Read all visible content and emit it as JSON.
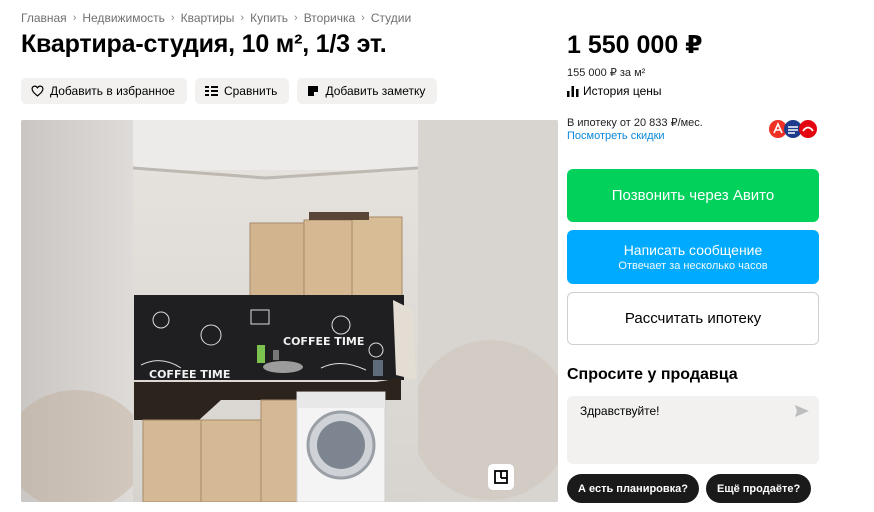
{
  "breadcrumbs": [
    "Главная",
    "Недвижимость",
    "Квартиры",
    "Купить",
    "Вторичка",
    "Студии"
  ],
  "title": "Квартира-студия, 10 м², 1/3 эт.",
  "actions": {
    "favorite": "Добавить в избранное",
    "compare": "Сравнить",
    "note": "Добавить заметку"
  },
  "gallery": {
    "poster_text_1": "COFFEE TIME",
    "poster_text_2": "COFFEE TIME"
  },
  "price": {
    "total": "1 550 000 ₽",
    "per_meter": "155 000 ₽ за м²",
    "history": "История цены"
  },
  "mortgage": {
    "text": "В ипотеку от 20 833 ₽/мес.",
    "discounts_link": "Посмотреть скидки"
  },
  "buttons": {
    "call": "Позвонить через Авито",
    "message": "Написать сообщение",
    "message_sub": "Отвечает за несколько часов",
    "calc": "Рассчитать ипотеку"
  },
  "ask": {
    "heading": "Спросите у продавца",
    "input_value": "Здравствуйте!",
    "chips": [
      "А есть планировка?",
      "Ещё продаёте?"
    ]
  },
  "colors": {
    "call_button": "#02d15c",
    "message_button": "#00aaff",
    "link": "#0a87d8",
    "chip_bg": "#1a1a1a"
  }
}
